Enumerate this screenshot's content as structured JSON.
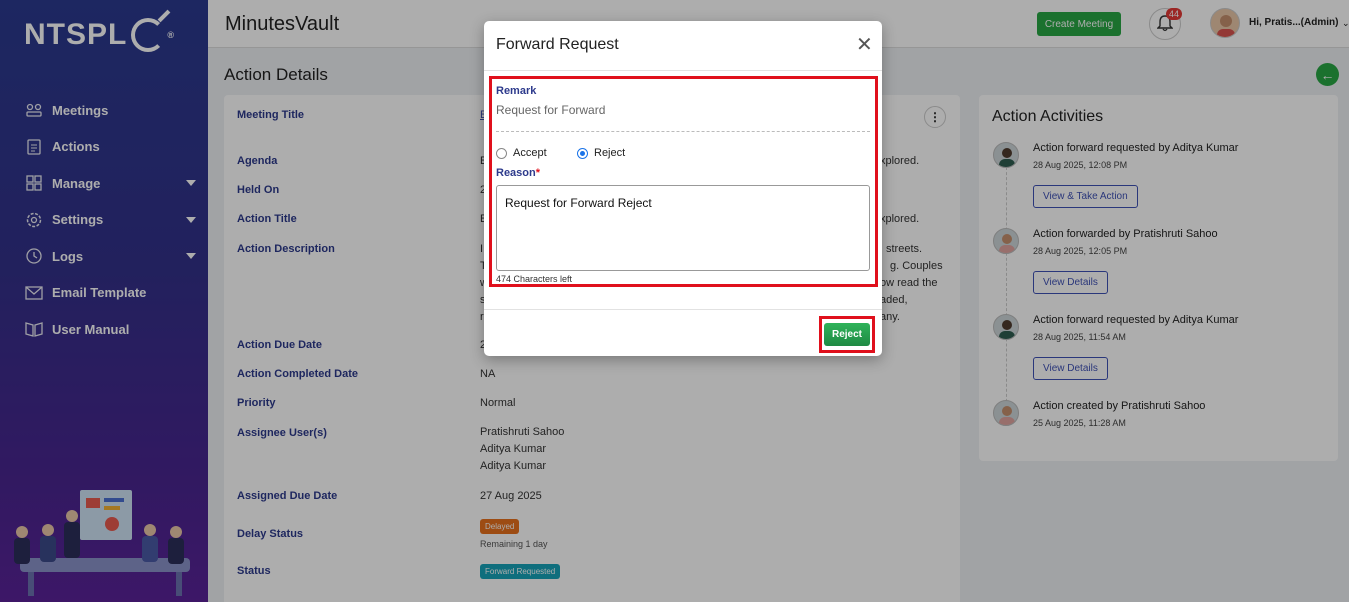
{
  "brand": {
    "logo_text": "NTSPL",
    "trademark": "®"
  },
  "sidebar": {
    "items": [
      {
        "label": "Meetings",
        "icon": "meetings-icon",
        "has_caret": false
      },
      {
        "label": "Actions",
        "icon": "actions-icon",
        "has_caret": false
      },
      {
        "label": "Manage",
        "icon": "manage-icon",
        "has_caret": true
      },
      {
        "label": "Settings",
        "icon": "settings-icon",
        "has_caret": true
      },
      {
        "label": "Logs",
        "icon": "logs-icon",
        "has_caret": true
      },
      {
        "label": "Email Template",
        "icon": "email-icon",
        "has_caret": false
      },
      {
        "label": "User Manual",
        "icon": "manual-icon",
        "has_caret": false
      }
    ]
  },
  "header": {
    "app_title": "MinutesVault",
    "create_meeting_label": "Create Meeting",
    "notification_count": "44",
    "user_greeting": "Hi, Pratis...(Admin)"
  },
  "page": {
    "heading": "Action Details"
  },
  "details": {
    "meeting_title_label": "Meeting Title",
    "meeting_title_value": "E",
    "agenda_label": "Agenda",
    "agenda_value_start": "E",
    "agenda_value_end": "xplored.",
    "held_on_label": "Held On",
    "held_on_value": "2",
    "action_title_label": "Action Title",
    "action_title_value_start": "E",
    "action_title_value_end": "xplored.",
    "action_desc_label": "Action Description",
    "action_desc_lines_start": [
      "I",
      "T",
      "w",
      "s",
      "r"
    ],
    "action_desc_lines_end": [
      "streets.",
      "g. Couples",
      "ow read the",
      "aded,",
      "any."
    ],
    "due_date_label": "Action Due Date",
    "due_date_value": "2",
    "completed_label": "Action Completed Date",
    "completed_value": "NA",
    "priority_label": "Priority",
    "priority_value": "Normal",
    "assignees_label": "Assignee User(s)",
    "assignees": [
      "Pratishruti Sahoo",
      "Aditya Kumar",
      "Aditya Kumar"
    ],
    "assigned_due_label": "Assigned Due Date",
    "assigned_due_value": "27 Aug 2025",
    "delay_label": "Delay Status",
    "delay_badge": "Delayed",
    "delay_note": "Remaining 1 day",
    "status_label": "Status",
    "status_badge": "Forward Requested",
    "colors": {
      "delayed": "#e8711c",
      "forward_requested": "#17a2b8"
    }
  },
  "activities": {
    "title": "Action Activities",
    "items": [
      {
        "text": "Action forward requested by Aditya Kumar",
        "time": "28 Aug 2025, 12:08 PM",
        "button": "View & Take Action"
      },
      {
        "text": "Action forwarded by Pratishruti Sahoo",
        "time": "28 Aug 2025, 12:05 PM",
        "button": "View Details"
      },
      {
        "text": "Action forward requested by Aditya Kumar",
        "time": "28 Aug 2025, 11:54 AM",
        "button": "View Details"
      },
      {
        "text": "Action created by Pratishruti Sahoo",
        "time": "25 Aug 2025, 11:28 AM",
        "button": ""
      }
    ]
  },
  "modal": {
    "title": "Forward Request",
    "remark_label": "Remark",
    "remark_value": "Request for Forward",
    "accept_label": "Accept",
    "reject_label": "Reject",
    "selected": "Reject",
    "reason_label": "Reason",
    "reason_required_mark": "*",
    "reason_value": "Request for Forward Reject",
    "chars_left": "474 Characters left",
    "submit_label": "Reject",
    "highlight_color": "#e0101c"
  }
}
